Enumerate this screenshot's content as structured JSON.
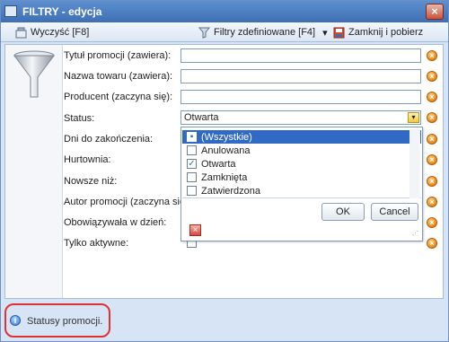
{
  "window": {
    "title": "FILTRY - edycja",
    "close_glyph": "×"
  },
  "toolbar": {
    "clear_label": "Wyczyść [F8]",
    "predefined_label": "Filtry zdefiniowane [F4]",
    "predefined_arrow": "▾",
    "close_fetch_label": "Zamknij i pobierz"
  },
  "form": {
    "fields": [
      {
        "label": "Tytuł promocji (zawiera):",
        "value": ""
      },
      {
        "label": "Nazwa towaru (zawiera):",
        "value": ""
      },
      {
        "label": "Producent (zaczyna się):",
        "value": ""
      },
      {
        "label": "Status:",
        "value": "Otwarta"
      },
      {
        "label": "Dni do zakończenia:",
        "value": ""
      },
      {
        "label": "Hurtownia:",
        "value": ""
      },
      {
        "label": "Nowsze niż:",
        "value": ""
      },
      {
        "label": "Autor promocji (zaczyna się):",
        "value": ""
      },
      {
        "label": "Obowiązywała w dzień:",
        "value": ""
      },
      {
        "label": "Tylko aktywne:",
        "value": ""
      }
    ],
    "clear_glyph": "×",
    "dropdown_arrow": "▾"
  },
  "status_popup": {
    "items": [
      {
        "label": "(Wszystkie)",
        "checked": false,
        "mark": "▪"
      },
      {
        "label": "Anulowana",
        "checked": false,
        "mark": ""
      },
      {
        "label": "Otwarta",
        "checked": true,
        "mark": "✓"
      },
      {
        "label": "Zamknięta",
        "checked": false,
        "mark": ""
      },
      {
        "label": "Zatwierdzona",
        "checked": false,
        "mark": ""
      }
    ],
    "ok_label": "OK",
    "cancel_label": "Cancel",
    "delete_glyph": "×",
    "grip_glyph": "⋰"
  },
  "statusbar": {
    "info_glyph": "i",
    "text": "Statusy promocji."
  },
  "icons": {
    "app": "filter-window-icon",
    "clear": "clear-filter-icon",
    "predefined": "funnel-icon",
    "close_fetch": "save-close-icon",
    "funnel": "funnel-large-icon",
    "clear_field": "clear-field-icon",
    "info": "info-icon"
  },
  "colors": {
    "title_bar": "#4a7cc0",
    "window_bg": "#d6e4f5",
    "selection": "#316ac5",
    "clear_field_orange": "#f08f1d",
    "highlight_frame": "#dd3333"
  }
}
